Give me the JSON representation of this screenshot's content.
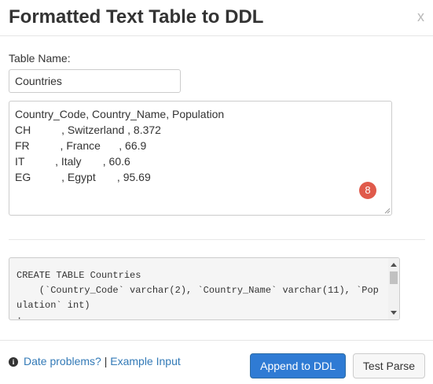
{
  "dialog": {
    "title": "Formatted Text Table to DDL",
    "close_label": "x"
  },
  "form": {
    "table_name_label": "Table Name:",
    "table_name_value": "Countries",
    "input_text_lines": [
      "Country_Code, Country_Name, Population",
      "CH          , Switzerland , 8.372",
      "FR          , France      , 66.9",
      "IT          , Italy       , 60.6",
      "EG          , Egypt       , 95.69"
    ],
    "badge_count": "8"
  },
  "output": {
    "ddl_lines": [
      "CREATE TABLE Countries",
      "    (`Country_Code` varchar(2), `Country_Name` varchar(11), `Pop",
      "ulation` int)",
      ";"
    ]
  },
  "footer": {
    "info_icon": "info-icon",
    "date_problems_link": "Date problems?",
    "separator": "|",
    "example_input_link": "Example Input",
    "append_button": "Append to DDL",
    "test_parse_button": "Test Parse"
  },
  "colors": {
    "primary": "#2f7bd4",
    "link": "#337ab7",
    "badge": "#e05a4b"
  }
}
